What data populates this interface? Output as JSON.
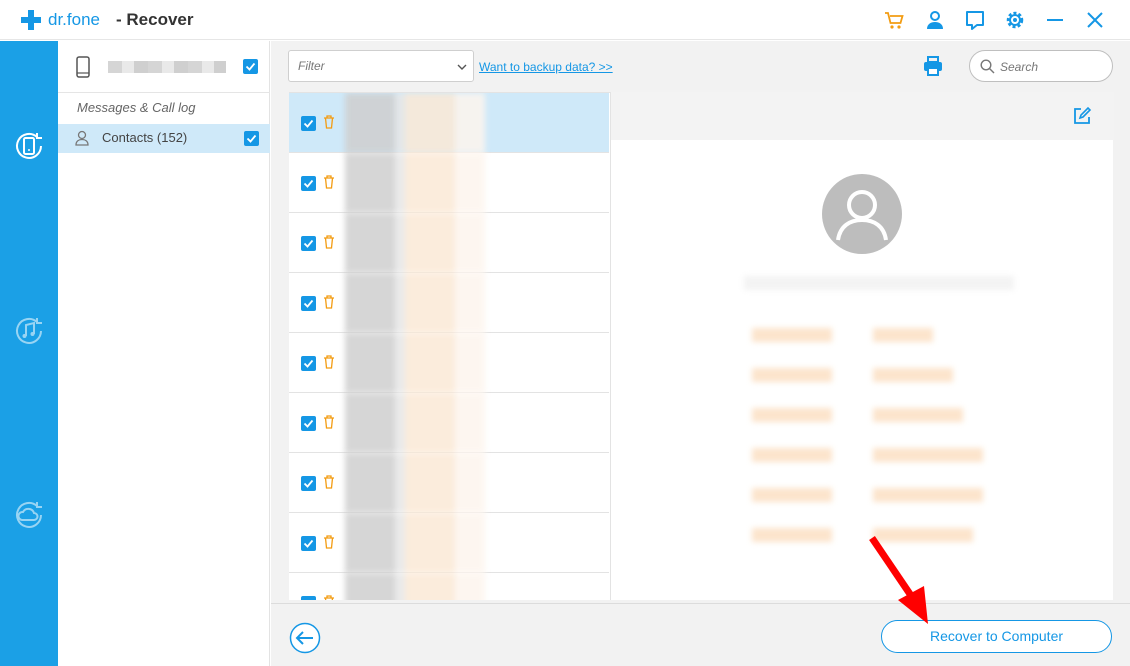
{
  "titlebar": {
    "brand": "dr.fone",
    "title": "- Recover"
  },
  "category_panel": {
    "section_label": "Messages & Call log",
    "contacts_label": "Contacts (152)"
  },
  "toolbar": {
    "filter_placeholder": "Filter",
    "backup_link": "Want to backup data? >>",
    "search_placeholder": "Search"
  },
  "footer": {
    "recover_label": "Recover to Computer"
  },
  "colors": {
    "accent": "#1597e5",
    "rail": "#1ba0e6",
    "cart": "#f39c12",
    "arrow": "#ff0000"
  },
  "icons": {
    "titlebar": [
      "cart-icon",
      "user-icon",
      "chat-icon",
      "settings-icon",
      "minimize-icon",
      "close-icon"
    ],
    "rail": [
      "device-recover-icon",
      "music-recover-icon",
      "cloud-recover-icon"
    ]
  }
}
